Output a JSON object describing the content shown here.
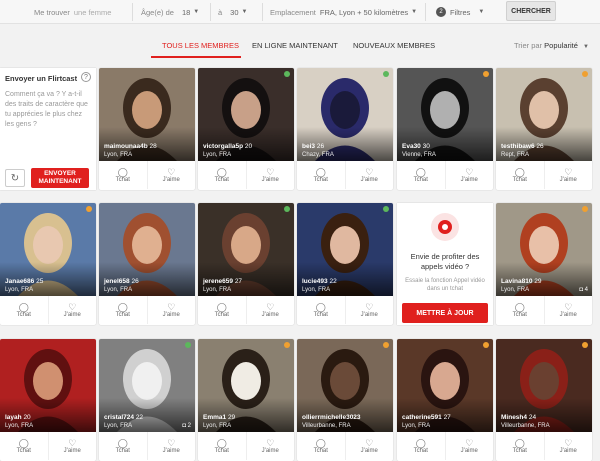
{
  "search": {
    "me_label": "Me trouver",
    "me_value": "une femme",
    "age_label": "Âge(e) de",
    "age_from": "18",
    "age_to_label": "à",
    "age_to": "30",
    "location_label": "Emplacement",
    "location_value": "FRA, Lyon + 50 kilomètres",
    "filters_count": "2",
    "filters_label": "Filtres",
    "search_button": "CHERCHER"
  },
  "tabs": [
    {
      "label": "TOUS LES MEMBRES",
      "active": true
    },
    {
      "label": "EN LIGNE MAINTENANT",
      "active": false
    },
    {
      "label": "NOUVEAUX MEMBRES",
      "active": false
    }
  ],
  "sort": {
    "label": "Trier par",
    "value": "Popularité"
  },
  "flirtcast": {
    "title": "Envoyer un Flirtcast",
    "help": "?",
    "text": "Comment ça va ? Y a-t-il des traits de caractère que tu apprécies le plus chez les gens ?",
    "refresh_icon": "refresh-icon",
    "send_label": "ENVOYER MAINTENANT"
  },
  "promo": {
    "title": "Envie de profiter des appels vidéo ?",
    "subtitle": "Essaie la fonction Appel vidéo dans un tchat",
    "button": "METTRE À JOUR"
  },
  "actions": {
    "chat": "Tchat",
    "like": "J'aime"
  },
  "colors": {
    "accent": "#e0201e",
    "online": "#5cb85c",
    "away": "#f0a030"
  },
  "profiles": [
    {
      "name": "maimounaa4b",
      "age": "28",
      "location": "Lyon, FRA",
      "status": "none",
      "photos": "",
      "bg": "#8a7a68",
      "fg": "#3a2a1e",
      "skin": "#c89a78"
    },
    {
      "name": "victorgalla5p",
      "age": "20",
      "location": "Lyon, FRA",
      "status": "online",
      "photos": "",
      "bg": "#3a2e2a",
      "fg": "#141010",
      "skin": "#c8a088"
    },
    {
      "name": "bei3",
      "age": "26",
      "location": "Chazy, FRA",
      "status": "online",
      "photos": "",
      "bg": "#d8d0c4",
      "fg": "#2a2a6a",
      "skin": "#1a1a3a"
    },
    {
      "name": "Eva30",
      "age": "30",
      "location": "Vienne, FRA",
      "status": "away",
      "photos": "",
      "bg": "#555",
      "fg": "#111",
      "skin": "#b0b0b0"
    },
    {
      "name": "testhibaw6",
      "age": "26",
      "location": "Rept, FRA",
      "status": "away",
      "photos": "",
      "bg": "#c8c0b0",
      "fg": "#5a4030",
      "skin": "#e0c0a8"
    },
    {
      "name": "Janae686",
      "age": "25",
      "location": "Lyon, FRA",
      "status": "away",
      "photos": "",
      "bg": "#5a7aa8",
      "fg": "#d8c090",
      "skin": "#e8c8b0"
    },
    {
      "name": "jenel658",
      "age": "26",
      "location": "Lyon, FRA",
      "status": "none",
      "photos": "",
      "bg": "#6a7890",
      "fg": "#a05030",
      "skin": "#e0b090"
    },
    {
      "name": "jerene659",
      "age": "27",
      "location": "Lyon, FRA",
      "status": "online",
      "photos": "",
      "bg": "#3a3028",
      "fg": "#6a4030",
      "skin": "#d8a888"
    },
    {
      "name": "lucie493",
      "age": "22",
      "location": "Lyon, FRA",
      "status": "online",
      "photos": "",
      "bg": "#2a3a6a",
      "fg": "#3a2010",
      "skin": "#e0b8a0"
    },
    {
      "name": "Lavina810",
      "age": "29",
      "location": "Lyon, FRA",
      "status": "away",
      "photos": "4",
      "bg": "#a09888",
      "fg": "#b04020",
      "skin": "#e8c0a8"
    },
    {
      "name": "layah",
      "age": "20",
      "location": "Lyon, FRA",
      "status": "none",
      "photos": "",
      "bg": "#b02020",
      "fg": "#601010",
      "skin": "#d09070"
    },
    {
      "name": "cristal724",
      "age": "22",
      "location": "Lyon, FRA",
      "status": "online",
      "photos": "2",
      "bg": "#808080",
      "fg": "#d0d0d0",
      "skin": "#f0f0f0"
    },
    {
      "name": "Emma1",
      "age": "29",
      "location": "Lyon, FRA",
      "status": "away",
      "photos": "",
      "bg": "#8a8070",
      "fg": "#2a2018",
      "skin": "#f0ece4"
    },
    {
      "name": "ollierrmichelle3023",
      "age": "",
      "location": "Villeurbanne, FRA",
      "status": "away",
      "photos": "",
      "bg": "#7a6858",
      "fg": "#2a1a10",
      "skin": "#6a4a38"
    },
    {
      "name": "catherine591",
      "age": "27",
      "location": "Lyon, FRA",
      "status": "away",
      "photos": "",
      "bg": "#5a3828",
      "fg": "#2a1410",
      "skin": "#d8a890"
    },
    {
      "name": "Minesh4",
      "age": "24",
      "location": "Villeurbanne, FRA",
      "status": "away",
      "photos": "",
      "bg": "#4a2a20",
      "fg": "#8a2018",
      "skin": "#6a4030"
    }
  ]
}
